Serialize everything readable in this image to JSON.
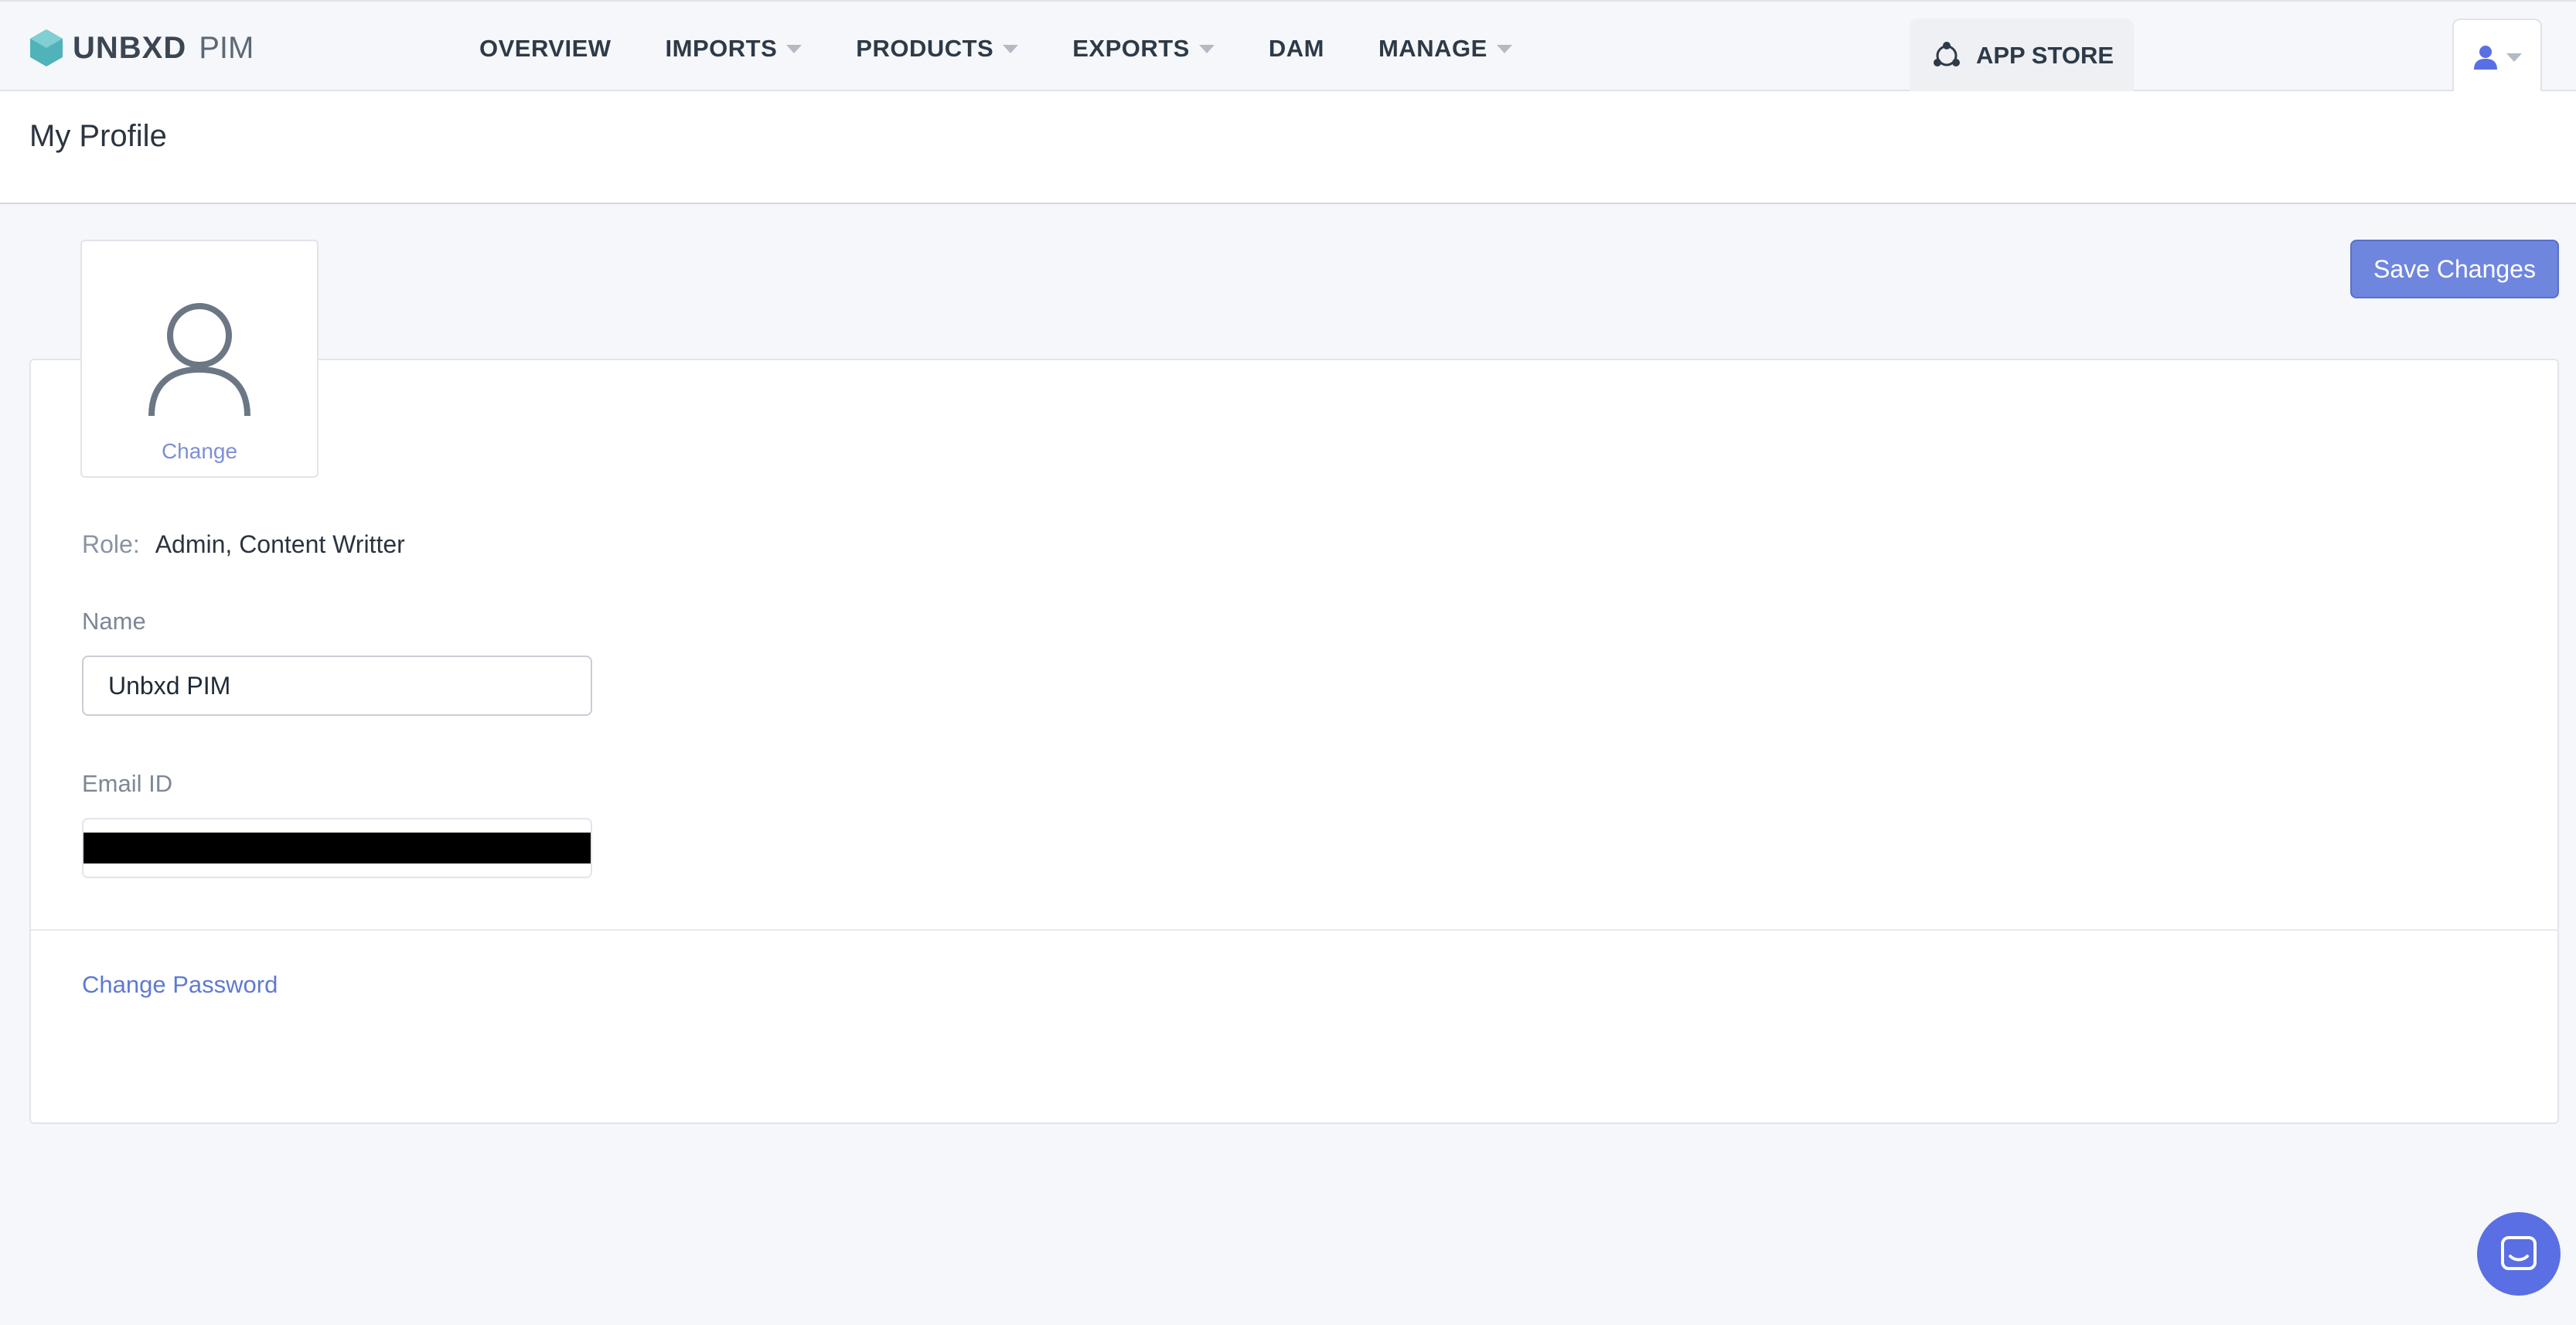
{
  "brand": {
    "name": "UNBXD",
    "product": "PIM"
  },
  "nav": {
    "items": [
      {
        "label": "OVERVIEW",
        "dropdown": false
      },
      {
        "label": "IMPORTS",
        "dropdown": true
      },
      {
        "label": "PRODUCTS",
        "dropdown": true
      },
      {
        "label": "EXPORTS",
        "dropdown": true
      },
      {
        "label": "DAM",
        "dropdown": false
      },
      {
        "label": "MANAGE",
        "dropdown": true
      }
    ],
    "app_store": "APP STORE",
    "icons": {
      "app_store": "app-store-icon",
      "user": "user-icon"
    }
  },
  "page": {
    "title": "My Profile"
  },
  "actions": {
    "save_label": "Save Changes"
  },
  "profile": {
    "avatar_change_label": "Change",
    "role_label": "Role:",
    "role_value": "Admin, Content Writter",
    "name_label": "Name",
    "name_value": "Unbxd PIM",
    "email_label": "Email ID",
    "change_password_label": "Change Password"
  },
  "colors": {
    "accent": "#6f86df",
    "link": "#5f7ad0",
    "logo": "#4fb3b9",
    "chat": "#5a6fe3"
  }
}
